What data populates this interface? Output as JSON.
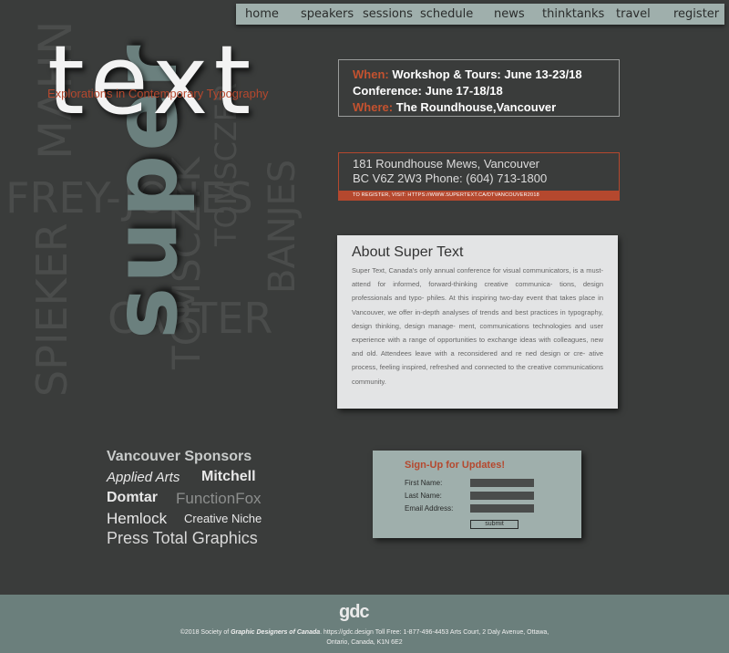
{
  "nav": {
    "items": [
      "home",
      "speakers",
      "sessions",
      "schedule",
      "news",
      "thinktanks",
      "travel",
      "register"
    ]
  },
  "ghost_words": [
    "MAHN",
    "FREY-JONES",
    "CARTER",
    "SPIEKER",
    "TOMSCZYK",
    "BANJES",
    "TOMSCZER"
  ],
  "hero": {
    "super": "super",
    "text": "text",
    "tagline": "Explorations in Contemporary Typography"
  },
  "event": {
    "when_label": "When:",
    "when_value": "Workshop & Tours: June 13-23/18",
    "conference": "Conference: June 17-18/18",
    "where_label": "Where:",
    "where_value": "The Roundhouse,Vancouver"
  },
  "address": {
    "line1": "181 Roundhouse Mews, Vancouver",
    "line2": "BC V6Z 2W3 Phone: (604) 713-1800",
    "register": "TO REGISTER, VISIT: HTTPS://WWW.SUPERTEXT.CA/DTVANCOUVER2018"
  },
  "about": {
    "title": "About Super Text",
    "body": "Super Text, Canada's only annual conference for visual communicators, is a must-attend for informed, forward-thinking creative communica- tions, design professionals and typo- philes. At this inspiring two-day event that takes place in Vancouver, we offer in-depth analyses of trends and best practices in typography, design thinking, design manage- ment, communications technologies and user experience with a range of opportunities to exchange ideas with colleagues, new and old. Attendees leave with a reconsidered and re ned design or cre- ative process, feeling inspired, refreshed and connected to the creative communications community."
  },
  "sponsors": {
    "heading": "Vancouver Sponsors",
    "items": [
      "Applied Arts",
      "Mitchell",
      "Domtar",
      "FunctionFox",
      "Hemlock",
      "Creative Niche",
      "Press Total Graphics"
    ]
  },
  "signup": {
    "title": "Sign-Up for Updates!",
    "first": "First Name:",
    "last": "Last Name:",
    "email": "Email Address:",
    "submit": "submit"
  },
  "footer": {
    "logo": "gdc",
    "pre": "©2018 Society of ",
    "org": "Graphic Designers of Canada",
    "post": ". https://gdc.design Toll Free: 1-877-496-4453 Arts Court, 2 Daly Avenue, Ottawa, Ontario, Canada, K1N 6E2"
  },
  "colors": {
    "background": "#3a3c3b",
    "accent": "#b5482e",
    "sage": "#9fafac",
    "super": "#6b807e"
  }
}
